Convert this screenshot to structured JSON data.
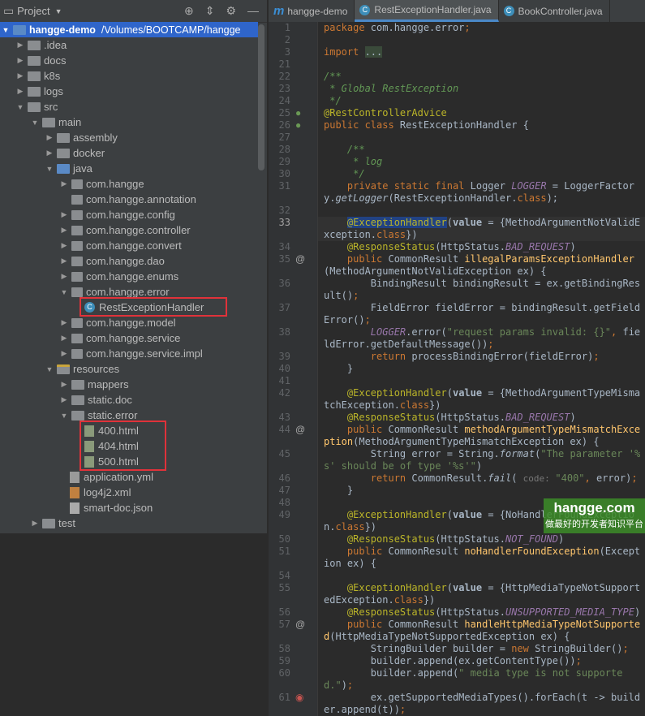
{
  "sidebar": {
    "title": "Project",
    "root": {
      "name": "hangge-demo",
      "path": "/Volumes/BOOTCAMP/hangge"
    },
    "items": [
      {
        "label": ".idea",
        "depth": 1,
        "arrow": "right",
        "icon": "folder"
      },
      {
        "label": "docs",
        "depth": 1,
        "arrow": "right",
        "icon": "folder"
      },
      {
        "label": "k8s",
        "depth": 1,
        "arrow": "right",
        "icon": "folder"
      },
      {
        "label": "logs",
        "depth": 1,
        "arrow": "right",
        "icon": "folder"
      },
      {
        "label": "src",
        "depth": 1,
        "arrow": "down",
        "icon": "folder"
      },
      {
        "label": "main",
        "depth": 2,
        "arrow": "down",
        "icon": "folder"
      },
      {
        "label": "assembly",
        "depth": 3,
        "arrow": "right",
        "icon": "folder"
      },
      {
        "label": "docker",
        "depth": 3,
        "arrow": "right",
        "icon": "folder"
      },
      {
        "label": "java",
        "depth": 3,
        "arrow": "down",
        "icon": "source-folder"
      },
      {
        "label": "com.hangge",
        "depth": 4,
        "arrow": "right",
        "icon": "package"
      },
      {
        "label": "com.hangge.annotation",
        "depth": 4,
        "arrow": "",
        "icon": "package"
      },
      {
        "label": "com.hangge.config",
        "depth": 4,
        "arrow": "right",
        "icon": "package"
      },
      {
        "label": "com.hangge.controller",
        "depth": 4,
        "arrow": "right",
        "icon": "package"
      },
      {
        "label": "com.hangge.convert",
        "depth": 4,
        "arrow": "right",
        "icon": "package"
      },
      {
        "label": "com.hangge.dao",
        "depth": 4,
        "arrow": "right",
        "icon": "package"
      },
      {
        "label": "com.hangge.enums",
        "depth": 4,
        "arrow": "right",
        "icon": "package"
      },
      {
        "label": "com.hangge.error",
        "depth": 4,
        "arrow": "down",
        "icon": "package"
      },
      {
        "label": "RestExceptionHandler",
        "depth": 5,
        "arrow": "",
        "icon": "class"
      },
      {
        "label": "com.hangge.model",
        "depth": 4,
        "arrow": "right",
        "icon": "package"
      },
      {
        "label": "com.hangge.service",
        "depth": 4,
        "arrow": "right",
        "icon": "package"
      },
      {
        "label": "com.hangge.service.impl",
        "depth": 4,
        "arrow": "right",
        "icon": "package"
      },
      {
        "label": "resources",
        "depth": 3,
        "arrow": "down",
        "icon": "resources-folder"
      },
      {
        "label": "mappers",
        "depth": 4,
        "arrow": "right",
        "icon": "folder"
      },
      {
        "label": "static.doc",
        "depth": 4,
        "arrow": "right",
        "icon": "folder"
      },
      {
        "label": "static.error",
        "depth": 4,
        "arrow": "down",
        "icon": "folder"
      },
      {
        "label": "400.html",
        "depth": 5,
        "arrow": "",
        "icon": "html"
      },
      {
        "label": "404.html",
        "depth": 5,
        "arrow": "",
        "icon": "html"
      },
      {
        "label": "500.html",
        "depth": 5,
        "arrow": "",
        "icon": "html"
      },
      {
        "label": "application.yml",
        "depth": 4,
        "arrow": "",
        "icon": "yml"
      },
      {
        "label": "log4j2.xml",
        "depth": 4,
        "arrow": "",
        "icon": "xml"
      },
      {
        "label": "smart-doc.json",
        "depth": 4,
        "arrow": "",
        "icon": "json"
      },
      {
        "label": "test",
        "depth": 2,
        "arrow": "right",
        "icon": "folder"
      }
    ]
  },
  "tabs": [
    {
      "label": "hangge-demo",
      "icon": "maven-icon"
    },
    {
      "label": "RestExceptionHandler.java",
      "icon": "class-icon",
      "active": true
    },
    {
      "label": "BookController.java",
      "icon": "class-icon"
    }
  ],
  "editor": {
    "current_line": "33",
    "lines": [
      {
        "n": "1",
        "t": [
          [
            "kw",
            "package "
          ],
          [
            "",
            "com.hangge.error"
          ],
          [
            "kw",
            ";"
          ]
        ]
      },
      {
        "n": "2",
        "t": []
      },
      {
        "n": "3",
        "t": [
          [
            "kw",
            "import "
          ],
          [
            "fb",
            "..."
          ]
        ]
      },
      {
        "n": "21",
        "t": []
      },
      {
        "n": "22",
        "t": [
          [
            "dc",
            "/**"
          ]
        ]
      },
      {
        "n": "23",
        "t": [
          [
            "dc",
            " * Global RestException"
          ]
        ]
      },
      {
        "n": "24",
        "t": [
          [
            "dc",
            " */"
          ]
        ]
      },
      {
        "n": "25",
        "t": [
          [
            "an",
            "@RestControllerAdvice"
          ]
        ],
        "g": "bean"
      },
      {
        "n": "26",
        "t": [
          [
            "kw",
            "public class "
          ],
          [
            "",
            "RestExceptionHandler {"
          ]
        ],
        "g": "bean"
      },
      {
        "n": "27",
        "t": []
      },
      {
        "n": "28",
        "t": [
          [
            "dc",
            "    /**"
          ]
        ]
      },
      {
        "n": "29",
        "t": [
          [
            "dc",
            "     * log"
          ]
        ]
      },
      {
        "n": "30",
        "t": [
          [
            "dc",
            "     */"
          ]
        ]
      },
      {
        "n": "31",
        "t": [
          [
            "kw",
            "    private static final "
          ],
          [
            "",
            "Logger "
          ],
          [
            "cn",
            "LOGGER"
          ],
          [
            "",
            " = LoggerFactory."
          ],
          [
            "it",
            "getLogger"
          ],
          [
            "",
            "(RestExceptionHandler."
          ],
          [
            "kw",
            "class"
          ],
          [
            "",
            ");"
          ]
        ]
      },
      {
        "n": "32",
        "t": []
      },
      {
        "n": "33",
        "t": [
          [
            "",
            "    "
          ],
          [
            "an hl",
            "@ExceptionHandler"
          ],
          [
            "",
            "("
          ],
          [
            "pm",
            "value"
          ],
          [
            "",
            " = {MethodArgumentNotValidException."
          ],
          [
            "kw",
            "class"
          ],
          [
            "",
            "})"
          ]
        ]
      },
      {
        "n": "34",
        "t": [
          [
            "an",
            "    @ResponseStatus"
          ],
          [
            "",
            "(HttpStatus."
          ],
          [
            "cn",
            "BAD_REQUEST"
          ],
          [
            "",
            ")"
          ]
        ]
      },
      {
        "n": "35",
        "t": [
          [
            "kw",
            "    public "
          ],
          [
            "",
            "CommonResult "
          ],
          [
            "fn",
            "illegalParamsExceptionHandler"
          ],
          [
            "",
            "(MethodArgumentNotValidException ex) {"
          ]
        ],
        "g": "@"
      },
      {
        "n": "36",
        "t": [
          [
            "",
            "        BindingResult bindingResult = ex.getBindingResult()"
          ],
          [
            "kw",
            ";"
          ]
        ]
      },
      {
        "n": "37",
        "t": [
          [
            "",
            "        FieldError fieldError = bindingResult.getFieldError()"
          ],
          [
            "kw",
            ";"
          ]
        ]
      },
      {
        "n": "38",
        "t": [
          [
            "cn",
            "        LOGGER"
          ],
          [
            "",
            ".error("
          ],
          [
            "st",
            "\"request params invalid: {}\""
          ],
          [
            "kw",
            ", "
          ],
          [
            "",
            "fieldError.getDefaultMessage())"
          ],
          [
            "kw",
            ";"
          ]
        ]
      },
      {
        "n": "39",
        "t": [
          [
            "kw",
            "        return "
          ],
          [
            "",
            "processBindingError(fieldError)"
          ],
          [
            "kw",
            ";"
          ]
        ]
      },
      {
        "n": "40",
        "t": [
          [
            "",
            "    }"
          ]
        ]
      },
      {
        "n": "41",
        "t": []
      },
      {
        "n": "42",
        "t": [
          [
            "an",
            "    @ExceptionHandler"
          ],
          [
            "",
            "("
          ],
          [
            "pm",
            "value"
          ],
          [
            "",
            " = {MethodArgumentTypeMismatchException."
          ],
          [
            "kw",
            "class"
          ],
          [
            "",
            "})"
          ]
        ]
      },
      {
        "n": "43",
        "t": [
          [
            "an",
            "    @ResponseStatus"
          ],
          [
            "",
            "(HttpStatus."
          ],
          [
            "cn",
            "BAD_REQUEST"
          ],
          [
            "",
            ")"
          ]
        ]
      },
      {
        "n": "44",
        "t": [
          [
            "kw",
            "    public "
          ],
          [
            "",
            "CommonResult "
          ],
          [
            "fn",
            "methodArgumentTypeMismatchException"
          ],
          [
            "",
            "(MethodArgumentTypeMismatchException ex) {"
          ]
        ],
        "g": "@"
      },
      {
        "n": "45",
        "t": [
          [
            "",
            "        String error = String."
          ],
          [
            "it",
            "format"
          ],
          [
            "",
            "("
          ],
          [
            "st",
            "\"The parameter '%s' should be of type '%s'\""
          ],
          [
            "",
            ")"
          ]
        ]
      },
      {
        "n": "46",
        "t": [
          [
            "kw",
            "        return "
          ],
          [
            "",
            "CommonResult."
          ],
          [
            "it",
            "fail"
          ],
          [
            "",
            "( "
          ],
          [
            "hint",
            "code: "
          ],
          [
            "st",
            "\"400\""
          ],
          [
            "kw",
            ", "
          ],
          [
            "",
            "error)"
          ],
          [
            "kw",
            ";"
          ]
        ]
      },
      {
        "n": "47",
        "t": [
          [
            "",
            "    }"
          ]
        ]
      },
      {
        "n": "48",
        "t": []
      },
      {
        "n": "49",
        "t": [
          [
            "an",
            "    @ExceptionHandler"
          ],
          [
            "",
            "("
          ],
          [
            "pm",
            "value"
          ],
          [
            "",
            " = {NoHandlerFoundException."
          ],
          [
            "kw",
            "class"
          ],
          [
            "",
            "})"
          ]
        ]
      },
      {
        "n": "50",
        "t": [
          [
            "an",
            "    @ResponseStatus"
          ],
          [
            "",
            "(HttpStatus."
          ],
          [
            "cn",
            "NOT_FOUND"
          ],
          [
            "",
            ")"
          ]
        ]
      },
      {
        "n": "51",
        "t": [
          [
            "kw",
            "    public "
          ],
          [
            "",
            "CommonResult "
          ],
          [
            "fn",
            "noHandlerFoundException"
          ],
          [
            "",
            "(Exception ex) {"
          ]
        ]
      },
      {
        "n": "54",
        "t": []
      },
      {
        "n": "55",
        "t": [
          [
            "an",
            "    @ExceptionHandler"
          ],
          [
            "",
            "("
          ],
          [
            "pm",
            "value"
          ],
          [
            "",
            " = {HttpMediaTypeNotSupportedException."
          ],
          [
            "kw",
            "class"
          ],
          [
            "",
            "})"
          ]
        ]
      },
      {
        "n": "56",
        "t": [
          [
            "an",
            "    @ResponseStatus"
          ],
          [
            "",
            "(HttpStatus."
          ],
          [
            "cn",
            "UNSUPPORTED_MEDIA_TYPE"
          ],
          [
            "",
            ")"
          ]
        ]
      },
      {
        "n": "57",
        "t": [
          [
            "kw",
            "    public "
          ],
          [
            "",
            "CommonResult "
          ],
          [
            "fn",
            "handleHttpMediaTypeNotSupported"
          ],
          [
            "",
            "(HttpMediaTypeNotSupportedException ex) {"
          ]
        ],
        "g": "@"
      },
      {
        "n": "58",
        "t": [
          [
            "",
            "        StringBuilder builder = "
          ],
          [
            "kw",
            "new "
          ],
          [
            "",
            "StringBuilder()"
          ],
          [
            "kw",
            ";"
          ]
        ]
      },
      {
        "n": "59",
        "t": [
          [
            "",
            "        builder.append(ex.getContentType())"
          ],
          [
            "kw",
            ";"
          ]
        ]
      },
      {
        "n": "60",
        "t": [
          [
            "",
            "        builder.append("
          ],
          [
            "st",
            "\" media type is not supported.\""
          ],
          [
            "",
            ")"
          ],
          [
            "kw",
            ";"
          ]
        ]
      },
      {
        "n": "61",
        "t": [
          [
            "",
            "        ex.getSupportedMediaTypes().forEach(t -> builder.append(t))"
          ],
          [
            "kw",
            ";"
          ]
        ],
        "g": "bp"
      }
    ]
  },
  "watermark": {
    "site": "hangge.com",
    "slogan": "做最好的开发者知识平台"
  },
  "colors": {
    "selection": "#2f65ca",
    "highlight_box": "#e0323a",
    "keyword": "#cc7832",
    "annotation": "#bbb529"
  }
}
